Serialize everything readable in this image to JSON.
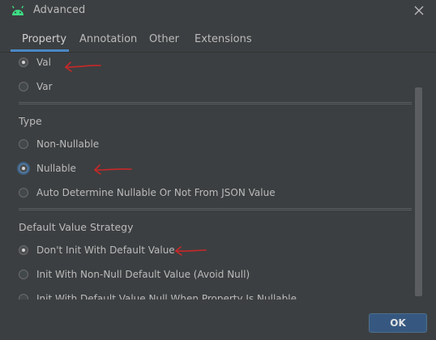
{
  "window": {
    "title": "Advanced",
    "app_icon": "android-icon",
    "close_icon": "close-icon"
  },
  "tabs": [
    {
      "label": "Property",
      "active": true
    },
    {
      "label": "Annotation",
      "active": false
    },
    {
      "label": "Other",
      "active": false
    },
    {
      "label": "Extensions",
      "active": false
    }
  ],
  "keyword_group": {
    "options": [
      {
        "label": "Val",
        "checked": true
      },
      {
        "label": "Var",
        "checked": false
      }
    ]
  },
  "type_group": {
    "title": "Type",
    "options": [
      {
        "label": "Non-Nullable",
        "checked": false
      },
      {
        "label": "Nullable",
        "checked": true
      },
      {
        "label": "Auto Determine Nullable Or Not From JSON Value",
        "checked": false
      }
    ]
  },
  "default_value_group": {
    "title": "Default Value Strategy",
    "options": [
      {
        "label": "Don't Init With Default Value",
        "checked": true
      },
      {
        "label": "Init With Non-Null Default Value (Avoid Null)",
        "checked": false
      },
      {
        "label": "Init With Default Value Null When Property Is Nullable",
        "checked": false
      }
    ]
  },
  "footer": {
    "ok_label": "OK"
  },
  "colors": {
    "accent": "#4a88c7",
    "annotation_arrow": "#c82828",
    "ok_button": "#365880"
  }
}
